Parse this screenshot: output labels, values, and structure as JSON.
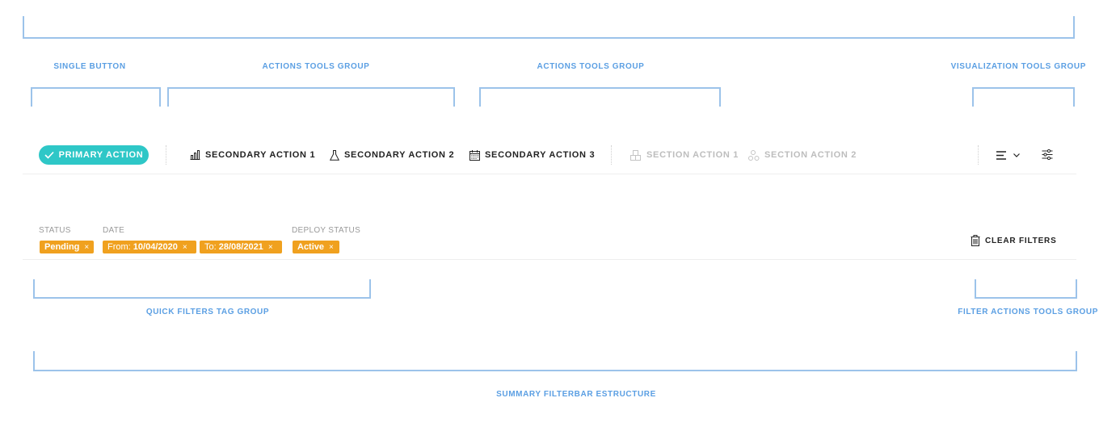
{
  "annotations": {
    "single_button": "SINGLE BUTTON",
    "actions_group_1": "ACTIONS TOOLS GROUP",
    "actions_group_2": "ACTIONS TOOLS GROUP",
    "visualization_group": "VISUALIZATION TOOLS GROUP",
    "quick_filters_group": "QUICK FILTERS TAG GROUP",
    "filter_actions_group": "FILTER ACTIONS TOOLS GROUP",
    "summary": "SUMMARY FILTERBAR ESTRUCTURE"
  },
  "toolbar": {
    "primary_action": "PRIMARY ACTION",
    "secondary_actions": [
      {
        "label": "SECONDARY ACTION 1",
        "icon": "bar-chart-icon"
      },
      {
        "label": "SECONDARY ACTION 2",
        "icon": "flask-icon"
      },
      {
        "label": "SECONDARY ACTION 3",
        "icon": "calendar-icon"
      }
    ],
    "section_actions": [
      {
        "label": "SECTION ACTION 1",
        "icon": "boxes-icon",
        "disabled": true
      },
      {
        "label": "SECTION ACTION 2",
        "icon": "nodes-icon",
        "disabled": true
      }
    ]
  },
  "filters": {
    "groups": [
      {
        "label": "STATUS"
      },
      {
        "label": "DATE"
      },
      {
        "label": "DEPLOY STATUS"
      }
    ],
    "tags": [
      {
        "prefix": "",
        "value": "Pending",
        "remove": "×"
      },
      {
        "prefix": "From:",
        "value": "10/04/2020",
        "remove": "×"
      },
      {
        "prefix": "To:",
        "value": "28/08/2021",
        "remove": "×"
      },
      {
        "prefix": "",
        "value": "Active",
        "remove": "×"
      }
    ],
    "clear_label": "CLEAR FILTERS"
  },
  "colors": {
    "primary": "#2ec7c7",
    "tag": "#f0a11f",
    "annotation": "#5b9fe3",
    "bracket": "#9cc3ea"
  }
}
